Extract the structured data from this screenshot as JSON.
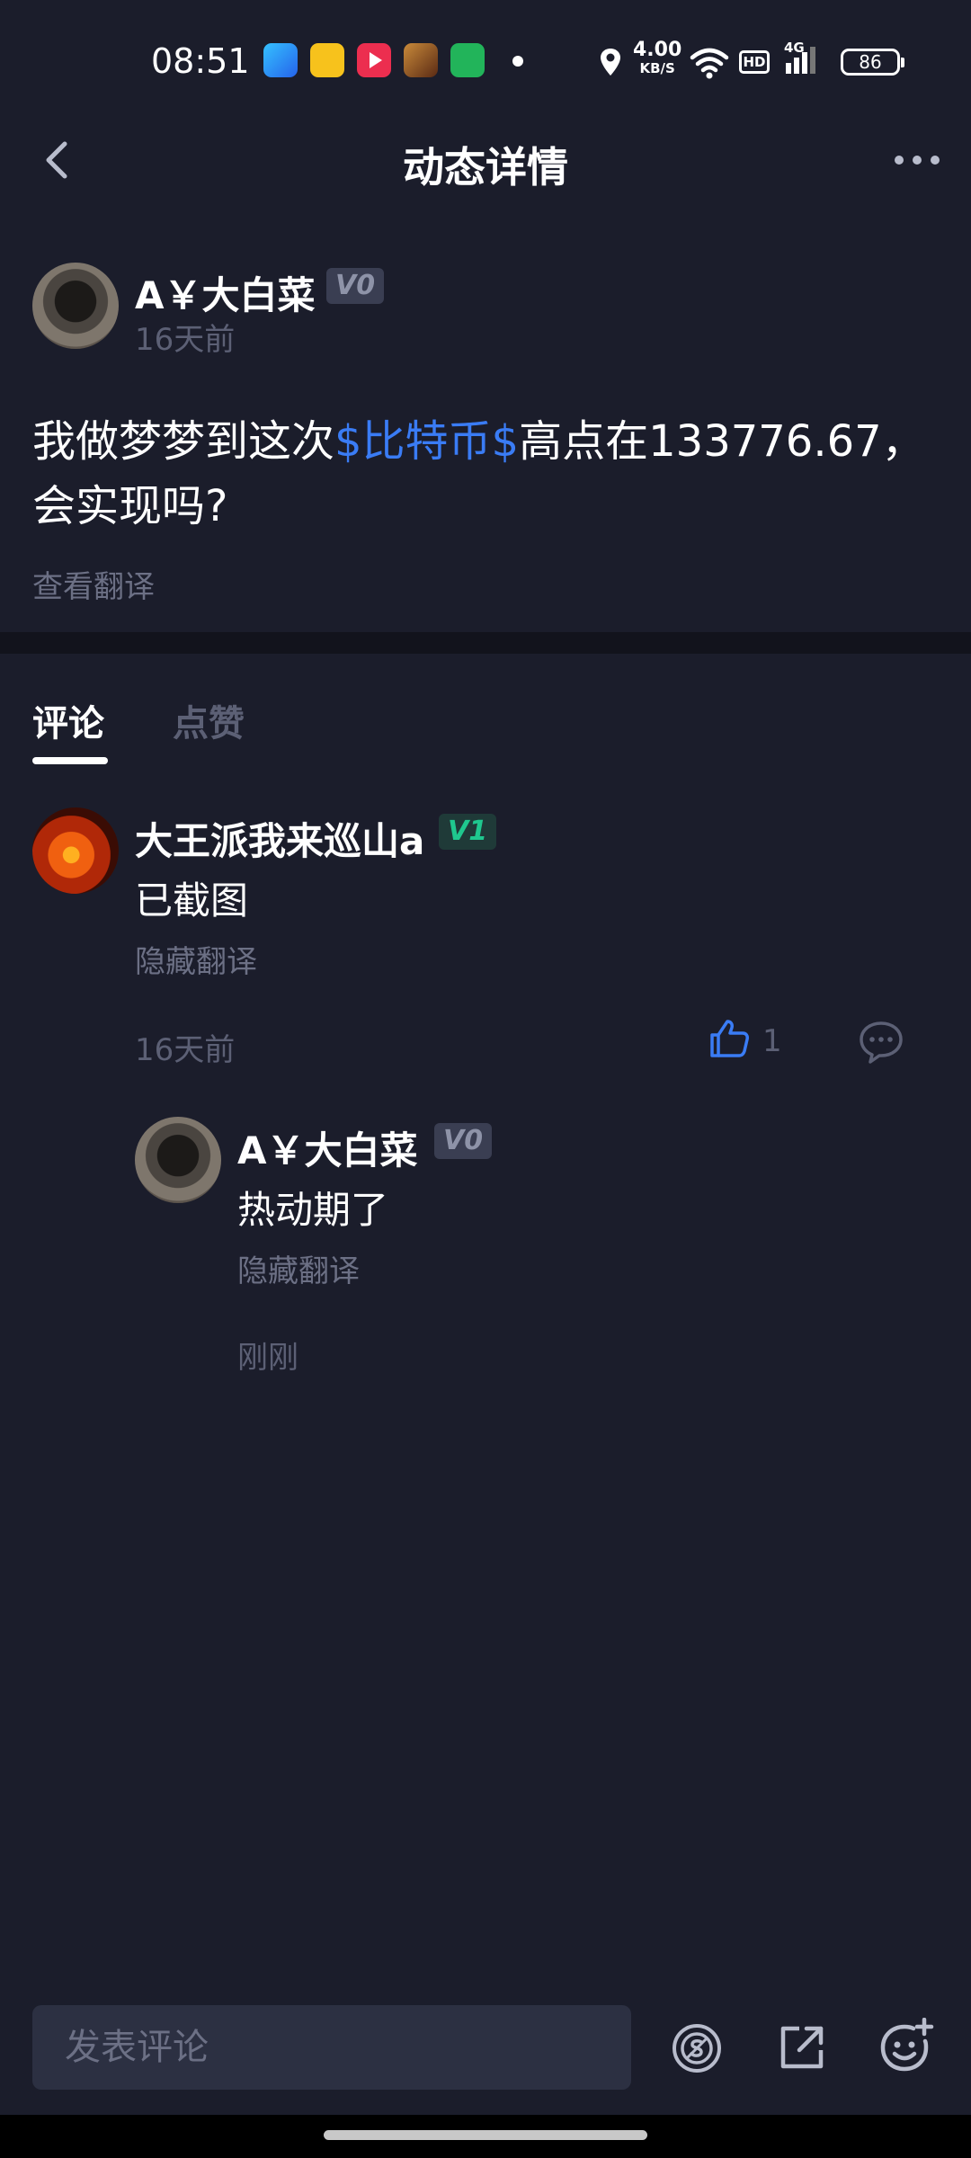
{
  "status_bar": {
    "time": "08:51",
    "net_speed_value": "4.00",
    "net_speed_unit": "KB/S",
    "network_type": "4G",
    "hd_label": "HD",
    "battery": "86"
  },
  "header": {
    "title": "动态详情"
  },
  "post": {
    "author": "A￥大白菜",
    "level": "V0",
    "time": "16天前",
    "text_before": "我做梦梦到这次",
    "tag": "$比特币$",
    "text_after": "高点在133776.67，会实现吗?",
    "translate_label": "查看翻译"
  },
  "tabs": {
    "comments": "评论",
    "likes": "点赞"
  },
  "comments": [
    {
      "author": "大王派我来巡山a",
      "level": "V1",
      "text": "已截图",
      "translate_label": "隐藏翻译",
      "time": "16天前",
      "likes": "1"
    }
  ],
  "reply": {
    "author": "A￥大白菜",
    "level": "V0",
    "text": "热动期了",
    "translate_label": "隐藏翻译",
    "time": "刚刚"
  },
  "bottom_bar": {
    "input_placeholder": "发表评论"
  },
  "colors": {
    "background": "#1b1d2b",
    "accent_link": "#3a7cf5",
    "level1_green": "#1fc78e",
    "muted_text": "#5c6075"
  }
}
